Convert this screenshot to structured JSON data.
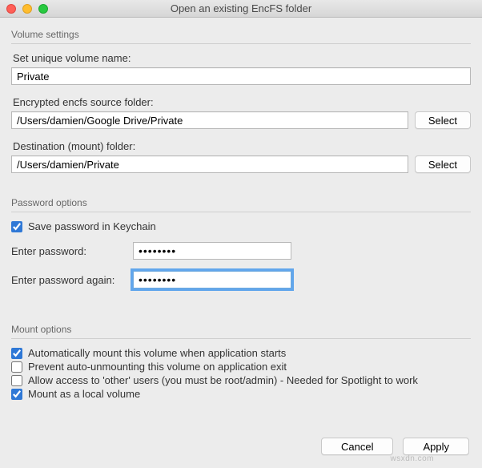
{
  "window": {
    "title": "Open an existing EncFS folder"
  },
  "groups": {
    "volume": "Volume settings",
    "password": "Password options",
    "mount": "Mount options"
  },
  "volume": {
    "nameLabel": "Set unique volume name:",
    "nameValue": "Private",
    "sourceLabel": "Encrypted encfs source folder:",
    "sourceValue": "/Users/damien/Google Drive/Private",
    "destLabel": "Destination (mount) folder:",
    "destValue": "/Users/damien/Private",
    "selectBtn": "Select"
  },
  "password": {
    "saveKeychain": {
      "label": "Save password in Keychain",
      "checked": true
    },
    "enterLabel": "Enter password:",
    "enterValue": "••••••••",
    "againLabel": "Enter password again:",
    "againValue": "••••••••"
  },
  "mount": {
    "autoMount": {
      "label": "Automatically mount this volume when application starts",
      "checked": true
    },
    "preventUnmount": {
      "label": "Prevent auto-unmounting this volume on application exit",
      "checked": false
    },
    "allowOther": {
      "label": "Allow access to 'other' users (you must be root/admin) - Needed for Spotlight to work",
      "checked": false
    },
    "localVolume": {
      "label": "Mount as a local volume",
      "checked": true
    }
  },
  "footer": {
    "cancel": "Cancel",
    "apply": "Apply"
  },
  "watermark": "wsxdn.com"
}
